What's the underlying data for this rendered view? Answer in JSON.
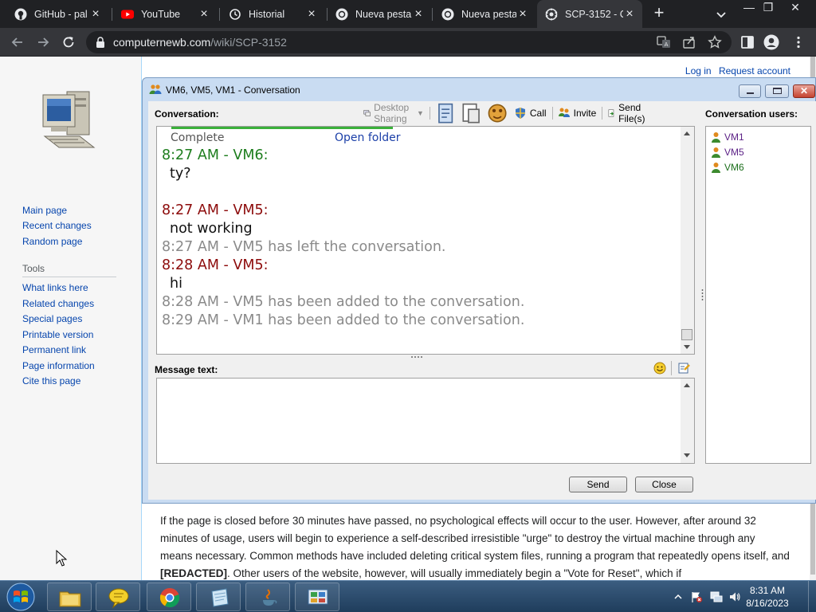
{
  "browser": {
    "tabs": [
      {
        "title": "GitHub - pal",
        "icon": "github-icon",
        "active": false
      },
      {
        "title": "YouTube",
        "icon": "youtube-icon",
        "active": false
      },
      {
        "title": "Historial",
        "icon": "history-icon",
        "active": false
      },
      {
        "title": "Nueva pesta",
        "icon": "chrome-icon",
        "active": false
      },
      {
        "title": "Nueva pesta",
        "icon": "chrome-icon",
        "active": false
      },
      {
        "title": "SCP-3152 - C",
        "icon": "scp-icon",
        "active": true
      }
    ],
    "url_host": "computernewb.com",
    "url_path": "/wiki/SCP-3152"
  },
  "wiki": {
    "personal": {
      "login": "Log in",
      "request": "Request account"
    },
    "nav": [
      "Main page",
      "Recent changes",
      "Random page"
    ],
    "tools_heading": "Tools",
    "tools": [
      "What links here",
      "Related changes",
      "Special pages",
      "Printable version",
      "Permanent link",
      "Page information",
      "Cite this page"
    ],
    "article": {
      "p1": "If the page is closed before 30 minutes have passed, no psychological effects will occur to the user. However, after around 32 minutes of usage, users will begin to experience a self-described irresistible \"urge\" to destroy the virtual machine through any means necessary. Common methods have included deleting critical system files, running a program that repeatedly opens itself, and",
      "redacted": "[REDACTED]",
      "p2": ". Other users of the website, however, will usually immediately begin a \"Vote for Reset\", which if"
    }
  },
  "conversation": {
    "title": "VM6, VM5, VM1 - Conversation",
    "conversation_label": "Conversation:",
    "toolbar": {
      "desktop_sharing": "Desktop Sharing",
      "call": "Call",
      "invite": "Invite",
      "send_files": "Send File(s)"
    },
    "file_transfer": {
      "status": "Complete",
      "open_folder": "Open folder"
    },
    "messages": [
      {
        "kind": "header",
        "color": "green",
        "text": "8:27 AM - VM6:"
      },
      {
        "kind": "text",
        "text": "ty?"
      },
      {
        "kind": "header",
        "color": "red",
        "text": "8:27 AM - VM5:"
      },
      {
        "kind": "text",
        "text": "not working"
      },
      {
        "kind": "system",
        "text": "8:27 AM - VM5 has left the conversation."
      },
      {
        "kind": "header",
        "color": "red",
        "text": "8:28 AM - VM5:"
      },
      {
        "kind": "text",
        "text": "hi"
      },
      {
        "kind": "system",
        "text": "8:28 AM - VM5 has been added to the conversation."
      },
      {
        "kind": "system",
        "text": "8:29 AM - VM1 has been added to the conversation."
      }
    ],
    "message_label": "Message text:",
    "message_value": "",
    "users_label": "Conversation users:",
    "users": [
      {
        "name": "VM1",
        "color": "purple"
      },
      {
        "name": "VM5",
        "color": "purple"
      },
      {
        "name": "VM6",
        "color": "green"
      }
    ],
    "send_label": "Send",
    "close_label": "Close"
  },
  "taskbar": {
    "apps": [
      "file-explorer-icon",
      "chat-balloon-icon",
      "chrome-icon",
      "notepad-icon",
      "java-icon",
      "control-panel-icon"
    ],
    "time": "8:31 AM",
    "date": "8/16/2023"
  }
}
